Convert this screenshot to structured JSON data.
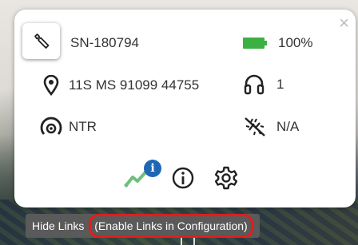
{
  "device": {
    "serial": "SN-180794",
    "battery": "100%",
    "location": "11S MS 91099 44755",
    "headset_count": "1",
    "signal": "NTR",
    "sensor": "N/A"
  },
  "actions": {
    "links_badge": "i"
  },
  "tooltip": {
    "prefix": "Hide Links",
    "highlighted": "(Enable Links in Configuration)"
  },
  "close": "×",
  "colors": {
    "battery": "#3cb043",
    "badge": "#1f67b5",
    "links_icon": "#6fbf7c",
    "highlight": "#e21d1d"
  }
}
